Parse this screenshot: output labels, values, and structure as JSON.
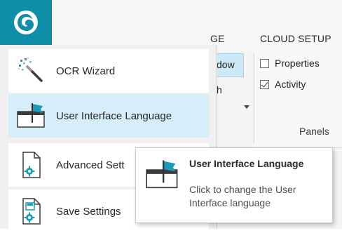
{
  "ribbon": {
    "tabs": [
      {
        "label": "GE"
      },
      {
        "label": "CLOUD SETUP"
      }
    ],
    "partial_labels": [
      "dow",
      "h"
    ],
    "group_panels": {
      "checkboxes": [
        {
          "label": "Properties",
          "checked": false
        },
        {
          "label": "Activity",
          "checked": true
        }
      ],
      "label": "Panels"
    }
  },
  "app_button": {
    "icon": "app-logo-icon",
    "color": "#0e8ea9"
  },
  "app_menu": {
    "items": [
      {
        "label": "OCR Wizard",
        "icon": "magic-wand-icon",
        "active": false
      },
      {
        "label": "User Interface Language",
        "icon": "window-flag-icon",
        "active": true
      },
      {
        "label": "Advanced Sett",
        "icon": "gear-document-icon",
        "active": false
      },
      {
        "label": "Save Settings",
        "icon": "save-settings-icon",
        "active": false
      }
    ]
  },
  "tooltip": {
    "title": "User Interface Language",
    "description": "Click to change the User Interface language",
    "icon": "window-flag-icon"
  },
  "colors": {
    "accent": "#0e8ea9",
    "selection": "#d5eef9",
    "flag": "#1a9bb8"
  }
}
